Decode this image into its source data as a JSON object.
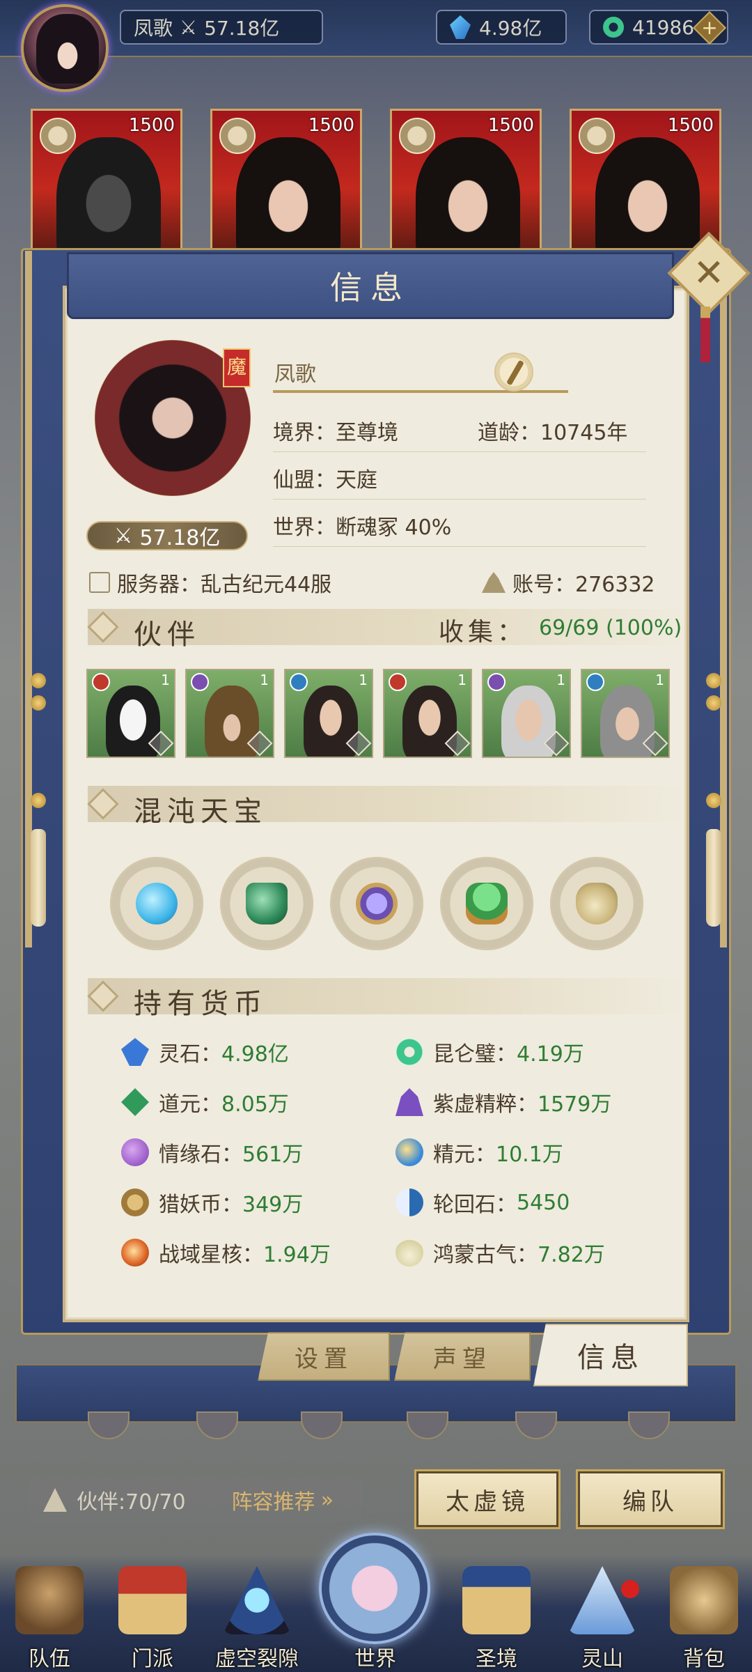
{
  "topbar": {
    "player_name": "凤歌",
    "power": "57.18亿",
    "spirit_stone": "4.98亿",
    "jade": "41986",
    "plus": "+"
  },
  "hero_cards": [
    {
      "cost": "1500"
    },
    {
      "cost": "1500"
    },
    {
      "cost": "1500"
    },
    {
      "cost": "1500"
    }
  ],
  "panel": {
    "title": "信息",
    "close": "✕"
  },
  "profile": {
    "tag": "魔",
    "name": "凤歌",
    "power": "57.18亿",
    "realm": "境界：至尊境",
    "age": "道龄：10745年",
    "alliance": "仙盟：天庭",
    "world": "世界：断魂冢 40%",
    "server": "服务器：乱古纪元44服",
    "account": "账号：276332"
  },
  "partners": {
    "header": "伙伴",
    "collect_label": "收集：",
    "collect_value": "69/69 (100%)",
    "items": [
      {
        "level": "1",
        "element_color": "#c0392b",
        "bg": "#7fae6a"
      },
      {
        "level": "1",
        "element_color": "#7a4fb0",
        "bg": "#7fae6a"
      },
      {
        "level": "1",
        "element_color": "#2f7fc0",
        "bg": "#7fae6a"
      },
      {
        "level": "1",
        "element_color": "#c0392b",
        "bg": "#7fae6a"
      },
      {
        "level": "1",
        "element_color": "#7a4fb0",
        "bg": "#7fae6a"
      },
      {
        "level": "1",
        "element_color": "#2f7fc0",
        "bg": "#7fae6a"
      }
    ]
  },
  "treasures": {
    "header": "混沌天宝",
    "items": [
      {
        "icon": "blue-gourd-icon",
        "color": "#3fb6e8"
      },
      {
        "icon": "green-cauldron-icon",
        "color": "#2f8a5a"
      },
      {
        "icon": "purple-mirror-icon",
        "color": "#6a4fb0"
      },
      {
        "icon": "jade-seal-icon",
        "color": "#3a9a4a"
      },
      {
        "icon": "gold-vase-icon",
        "color": "#c9b47a"
      }
    ]
  },
  "currencies": {
    "header": "持有货币",
    "items": [
      {
        "label": "灵石：",
        "value": "4.98亿",
        "color": "#3a78d8"
      },
      {
        "label": "昆仑璧：",
        "value": "4.19万",
        "color": "#3ec48d"
      },
      {
        "label": "道元：",
        "value": "8.05万",
        "color": "#2f9a5a"
      },
      {
        "label": "紫虚精粹：",
        "value": "1579万",
        "color": "#7a4fc0"
      },
      {
        "label": "情缘石：",
        "value": "561万",
        "color": "#9a5ac8"
      },
      {
        "label": "精元：",
        "value": "10.1万",
        "color": "#3a8ad8"
      },
      {
        "label": "猎妖币：",
        "value": "349万",
        "color": "#a07a3a"
      },
      {
        "label": "轮回石：",
        "value": "5450",
        "color": "#2a6ab0"
      },
      {
        "label": "战域星核：",
        "value": "1.94万",
        "color": "#e06a2a"
      },
      {
        "label": "鸿蒙古气：",
        "value": "7.82万",
        "color": "#d8d0a0"
      }
    ]
  },
  "tabs": {
    "settings": "设置",
    "reputation": "声望",
    "info": "信息"
  },
  "bottom": {
    "partner_count": "伙伴:70/70",
    "lineup_recommend": "阵容推荐",
    "taixu_mirror": "太虚镜",
    "formation": "编队"
  },
  "nav": [
    {
      "label": "队伍",
      "icon": "team-icon"
    },
    {
      "label": "门派",
      "icon": "sect-icon"
    },
    {
      "label": "虚空裂隙",
      "icon": "void-rift-icon"
    },
    {
      "label": "世界",
      "icon": "world-icon"
    },
    {
      "label": "圣境",
      "icon": "holy-realm-icon"
    },
    {
      "label": "灵山",
      "icon": "spirit-mountain-icon"
    },
    {
      "label": "背包",
      "icon": "backpack-icon"
    }
  ]
}
